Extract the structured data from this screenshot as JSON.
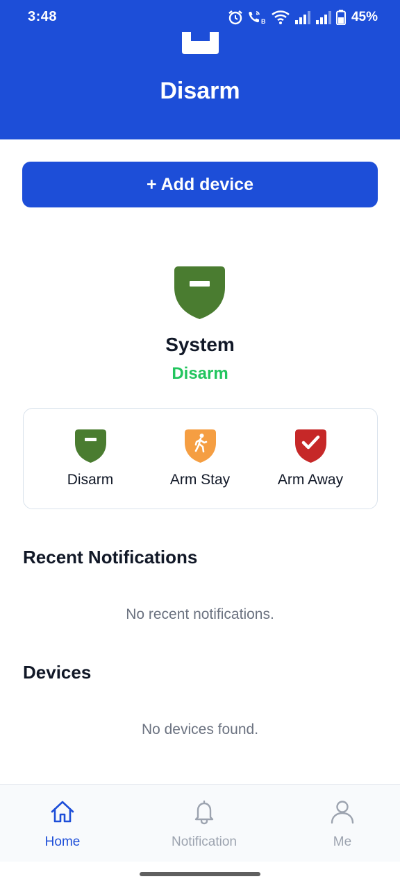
{
  "status_bar": {
    "time": "3:48",
    "battery": "45%",
    "icons": [
      "alarm-clock-icon",
      "wifi-calling-icon",
      "wifi-icon",
      "signal-icon",
      "signal-icon",
      "battery-icon"
    ]
  },
  "header": {
    "title": "Disarm",
    "background_color": "#1d4ed8"
  },
  "actions": {
    "add_device_label": "+ Add device"
  },
  "system": {
    "title": "System",
    "status": "Disarm",
    "status_color": "#22c55e",
    "icon": "shield-disarm-icon"
  },
  "modes": [
    {
      "label": "Disarm",
      "icon": "shield-minus-icon",
      "color": "#4a7c30"
    },
    {
      "label": "Arm Stay",
      "icon": "shield-walking-person-icon",
      "color": "#f59e42"
    },
    {
      "label": "Arm Away",
      "icon": "shield-check-icon",
      "color": "#c62828"
    }
  ],
  "notifications": {
    "title": "Recent Notifications",
    "empty_text": "No recent notifications."
  },
  "devices": {
    "title": "Devices",
    "empty_text": "No devices found."
  },
  "bottom_nav": {
    "active_color": "#1d4ed8",
    "inactive_color": "#9ca3af",
    "items": [
      {
        "label": "Home",
        "icon": "home-icon",
        "active": true
      },
      {
        "label": "Notification",
        "icon": "bell-icon",
        "active": false
      },
      {
        "label": "Me",
        "icon": "user-icon",
        "active": false
      }
    ]
  }
}
